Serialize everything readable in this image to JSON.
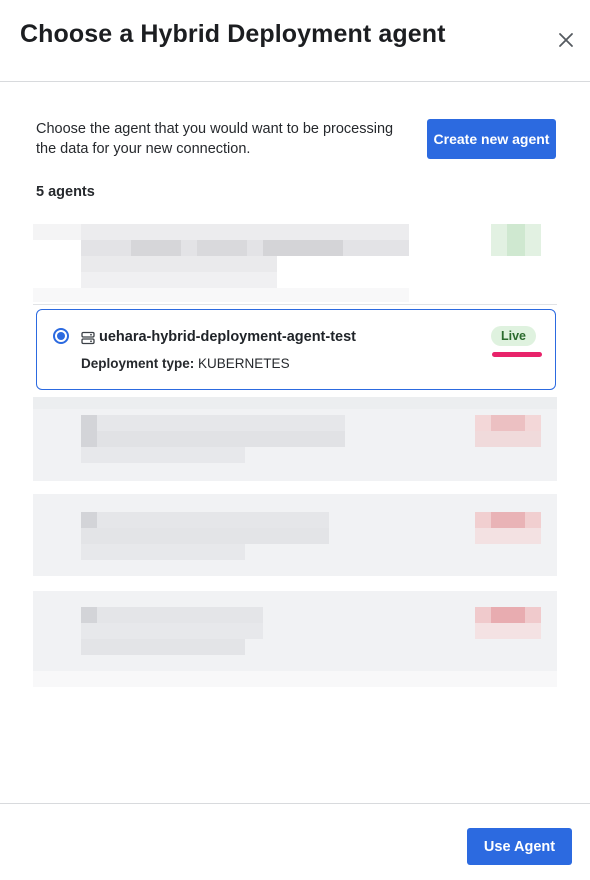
{
  "dialog": {
    "title": "Choose a Hybrid Deployment agent",
    "close_icon": "close-icon"
  },
  "intro": {
    "text": "Choose the agent that you would want to be processing the data for your new connection.",
    "create_button": "Create new agent"
  },
  "agents": {
    "count_label": "5 agents",
    "selected": {
      "name": "uehara-hybrid-deployment-agent-test",
      "deployment_label": "Deployment type:",
      "deployment_value": "KUBERNETES",
      "status": "Live",
      "status_color": "#2b6b2e",
      "icon": "server-icon"
    }
  },
  "footer": {
    "use_button": "Use Agent"
  },
  "colors": {
    "accent": "#2c6ae0",
    "annotation": "#e8236a"
  }
}
